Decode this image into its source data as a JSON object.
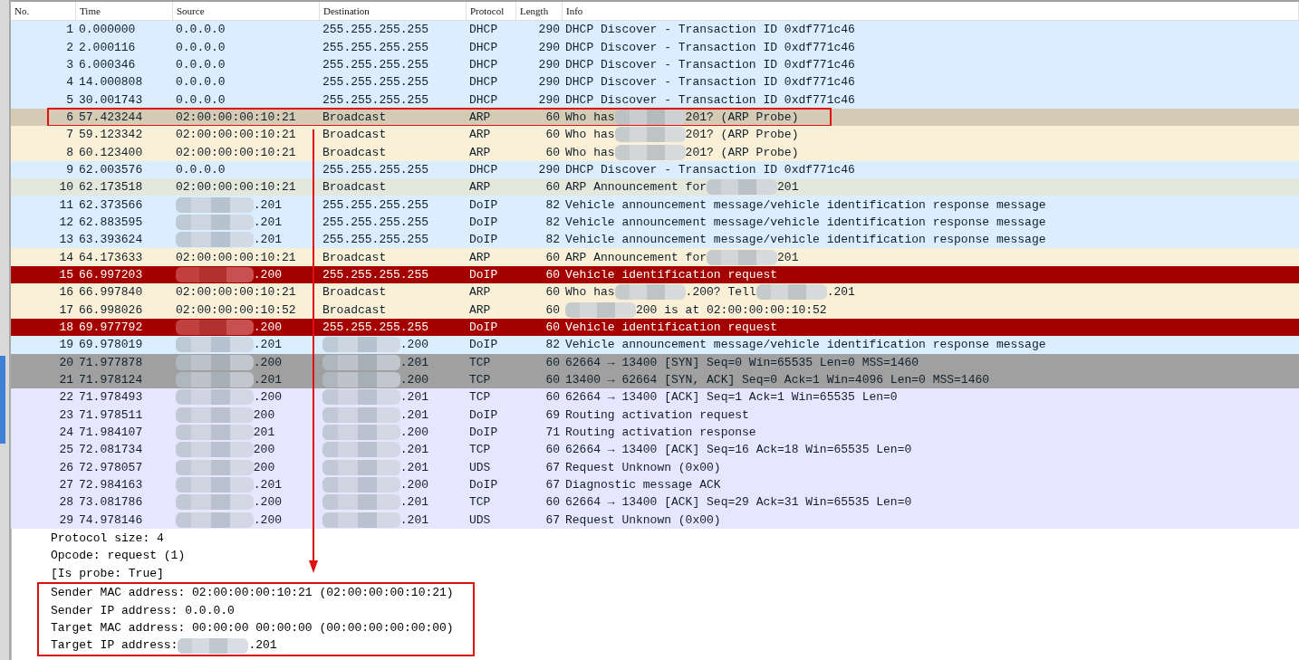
{
  "packet_list": {
    "columns": [
      "No.",
      "Time",
      "Source",
      "Destination",
      "Protocol",
      "Length",
      "Info"
    ],
    "rows": [
      {
        "no": "1",
        "time": "0.000000",
        "source": "0.0.0.0",
        "destination": "255.255.255.255",
        "protocol": "DHCP",
        "length": "290",
        "info": "DHCP Discover - Transaction ID 0xdf771c46",
        "color": "#daeeff",
        "highlighted": false
      },
      {
        "no": "2",
        "time": "2.000116",
        "source": "0.0.0.0",
        "destination": "255.255.255.255",
        "protocol": "DHCP",
        "length": "290",
        "info": "DHCP Discover - Transaction ID 0xdf771c46",
        "color": "#daeeff",
        "highlighted": false
      },
      {
        "no": "3",
        "time": "6.000346",
        "source": "0.0.0.0",
        "destination": "255.255.255.255",
        "protocol": "DHCP",
        "length": "290",
        "info": "DHCP Discover - Transaction ID 0xdf771c46",
        "color": "#daeeff",
        "highlighted": false
      },
      {
        "no": "4",
        "time": "14.000808",
        "source": "0.0.0.0",
        "destination": "255.255.255.255",
        "protocol": "DHCP",
        "length": "290",
        "info": "DHCP Discover - Transaction ID 0xdf771c46",
        "color": "#daeeff",
        "highlighted": false
      },
      {
        "no": "5",
        "time": "30.001743",
        "source": "0.0.0.0",
        "destination": "255.255.255.255",
        "protocol": "DHCP",
        "length": "290",
        "info": "DHCP Discover - Transaction ID 0xdf771c46",
        "color": "#daeeff",
        "highlighted": false
      },
      {
        "no": "6",
        "time": "57.423244",
        "source": "02:00:00:00:10:21",
        "destination": "Broadcast",
        "protocol": "ARP",
        "length": "60",
        "info": [
          {
            "kind": "text",
            "text": "Who has"
          },
          {
            "kind": "blur"
          },
          {
            "kind": "text",
            "text": "201? (ARP Probe)"
          }
        ],
        "color": "#d5cbb5",
        "highlighted": true
      },
      {
        "no": "7",
        "time": "59.123342",
        "source": "02:00:00:00:10:21",
        "destination": "Broadcast",
        "protocol": "ARP",
        "length": "60",
        "info": [
          {
            "kind": "text",
            "text": "Who has"
          },
          {
            "kind": "blur"
          },
          {
            "kind": "text",
            "text": "201? (ARP Probe)"
          }
        ],
        "color": "#faf0d8",
        "highlighted": false
      },
      {
        "no": "8",
        "time": "60.123400",
        "source": "02:00:00:00:10:21",
        "destination": "Broadcast",
        "protocol": "ARP",
        "length": "60",
        "info": [
          {
            "kind": "text",
            "text": "Who has"
          },
          {
            "kind": "blur"
          },
          {
            "kind": "text",
            "text": "201? (ARP Probe)"
          }
        ],
        "color": "#faf0d8",
        "highlighted": false
      },
      {
        "no": "9",
        "time": "62.003576",
        "source": "0.0.0.0",
        "destination": "255.255.255.255",
        "protocol": "DHCP",
        "length": "290",
        "info": "DHCP Discover - Transaction ID 0xdf771c46",
        "color": "#daeeff",
        "highlighted": false
      },
      {
        "no": "10",
        "time": "62.173518",
        "source": "02:00:00:00:10:21",
        "destination": "Broadcast",
        "protocol": "ARP",
        "length": "60",
        "info": [
          {
            "kind": "text",
            "text": "ARP Announcement for"
          },
          {
            "kind": "blur"
          },
          {
            "kind": "text",
            "text": "201"
          }
        ],
        "color": "#e3e7dc",
        "highlighted": false
      },
      {
        "no": "11",
        "time": "62.373566",
        "source": [
          {
            "kind": "blur"
          },
          {
            "kind": "text",
            "text": ".201"
          }
        ],
        "destination": "255.255.255.255",
        "protocol": "DoIP",
        "length": "82",
        "info": "Vehicle announcement message/vehicle identification response message",
        "color": "#daeeff",
        "highlighted": false
      },
      {
        "no": "12",
        "time": "62.883595",
        "source": [
          {
            "kind": "blur"
          },
          {
            "kind": "text",
            "text": ".201"
          }
        ],
        "destination": "255.255.255.255",
        "protocol": "DoIP",
        "length": "82",
        "info": "Vehicle announcement message/vehicle identification response message",
        "color": "#daeeff",
        "highlighted": false
      },
      {
        "no": "13",
        "time": "63.393624",
        "source": [
          {
            "kind": "blur"
          },
          {
            "kind": "text",
            "text": ".201"
          }
        ],
        "destination": "255.255.255.255",
        "protocol": "DoIP",
        "length": "82",
        "info": "Vehicle announcement message/vehicle identification response message",
        "color": "#daeeff",
        "highlighted": false
      },
      {
        "no": "14",
        "time": "64.173633",
        "source": "02:00:00:00:10:21",
        "destination": "Broadcast",
        "protocol": "ARP",
        "length": "60",
        "info": [
          {
            "kind": "text",
            "text": "ARP Announcement for"
          },
          {
            "kind": "blur"
          },
          {
            "kind": "text",
            "text": "201"
          }
        ],
        "color": "#faf0d8",
        "highlighted": false
      },
      {
        "no": "15",
        "time": "66.997203",
        "source": [
          {
            "kind": "blur"
          },
          {
            "kind": "text",
            "text": ".200"
          }
        ],
        "destination": "255.255.255.255",
        "protocol": "DoIP",
        "length": "60",
        "info": "Vehicle identification request",
        "color": "#a40000",
        "highlighted": false
      },
      {
        "no": "16",
        "time": "66.997840",
        "source": "02:00:00:00:10:21",
        "destination": "Broadcast",
        "protocol": "ARP",
        "length": "60",
        "info": [
          {
            "kind": "text",
            "text": "Who has"
          },
          {
            "kind": "blur"
          },
          {
            "kind": "text",
            "text": ".200? Tell"
          },
          {
            "kind": "blur"
          },
          {
            "kind": "text",
            "text": ".201"
          }
        ],
        "color": "#faf0d8",
        "highlighted": false
      },
      {
        "no": "17",
        "time": "66.998026",
        "source": "02:00:00:00:10:52",
        "destination": "Broadcast",
        "protocol": "ARP",
        "length": "60",
        "info": [
          {
            "kind": "blur"
          },
          {
            "kind": "text",
            "text": "200 is at 02:00:00:00:10:52"
          }
        ],
        "color": "#faf0d8",
        "highlighted": false
      },
      {
        "no": "18",
        "time": "69.977792",
        "source": [
          {
            "kind": "blur"
          },
          {
            "kind": "text",
            "text": ".200"
          }
        ],
        "destination": "255.255.255.255",
        "protocol": "DoIP",
        "length": "60",
        "info": "Vehicle identification request",
        "color": "#a40000",
        "highlighted": false
      },
      {
        "no": "19",
        "time": "69.978019",
        "source": [
          {
            "kind": "blur"
          },
          {
            "kind": "text",
            "text": ".201"
          }
        ],
        "destination": [
          {
            "kind": "blur"
          },
          {
            "kind": "text",
            "text": ".200"
          }
        ],
        "protocol": "DoIP",
        "length": "82",
        "info": "Vehicle announcement message/vehicle identification response message",
        "color": "#daeeff",
        "highlighted": false
      },
      {
        "no": "20",
        "time": "71.977878",
        "source": [
          {
            "kind": "blur"
          },
          {
            "kind": "text",
            "text": ".200"
          }
        ],
        "destination": [
          {
            "kind": "blur"
          },
          {
            "kind": "text",
            "text": ".201"
          }
        ],
        "protocol": "TCP",
        "length": "60",
        "info": "62664 → 13400 [SYN] Seq=0 Win=65535 Len=0 MSS=1460",
        "color": "#a0a0a0",
        "highlighted": false
      },
      {
        "no": "21",
        "time": "71.978124",
        "source": [
          {
            "kind": "blur"
          },
          {
            "kind": "text",
            "text": ".201"
          }
        ],
        "destination": [
          {
            "kind": "blur"
          },
          {
            "kind": "text",
            "text": ".200"
          }
        ],
        "protocol": "TCP",
        "length": "60",
        "info": "13400 → 62664 [SYN, ACK] Seq=0 Ack=1 Win=4096 Len=0 MSS=1460",
        "color": "#a0a0a0",
        "highlighted": false
      },
      {
        "no": "22",
        "time": "71.978493",
        "source": [
          {
            "kind": "blur"
          },
          {
            "kind": "text",
            "text": ".200"
          }
        ],
        "destination": [
          {
            "kind": "blur"
          },
          {
            "kind": "text",
            "text": ".201"
          }
        ],
        "protocol": "TCP",
        "length": "60",
        "info": "62664 → 13400 [ACK] Seq=1 Ack=1 Win=65535 Len=0",
        "color": "#e7e6ff",
        "highlighted": false
      },
      {
        "no": "23",
        "time": "71.978511",
        "source": [
          {
            "kind": "blur"
          },
          {
            "kind": "text",
            "text": "200"
          }
        ],
        "destination": [
          {
            "kind": "blur"
          },
          {
            "kind": "text",
            "text": ".201"
          }
        ],
        "protocol": "DoIP",
        "length": "69",
        "info": "Routing activation request",
        "color": "#e7e6ff",
        "highlighted": false
      },
      {
        "no": "24",
        "time": "71.984107",
        "source": [
          {
            "kind": "blur"
          },
          {
            "kind": "text",
            "text": "201"
          }
        ],
        "destination": [
          {
            "kind": "blur"
          },
          {
            "kind": "text",
            "text": ".200"
          }
        ],
        "protocol": "DoIP",
        "length": "71",
        "info": "Routing activation response",
        "color": "#e7e6ff",
        "highlighted": false
      },
      {
        "no": "25",
        "time": "72.081734",
        "source": [
          {
            "kind": "blur"
          },
          {
            "kind": "text",
            "text": "200"
          }
        ],
        "destination": [
          {
            "kind": "blur"
          },
          {
            "kind": "text",
            "text": ".201"
          }
        ],
        "protocol": "TCP",
        "length": "60",
        "info": "62664 → 13400 [ACK] Seq=16 Ack=18 Win=65535 Len=0",
        "color": "#e7e6ff",
        "highlighted": false
      },
      {
        "no": "26",
        "time": "72.978057",
        "source": [
          {
            "kind": "blur"
          },
          {
            "kind": "text",
            "text": "200"
          }
        ],
        "destination": [
          {
            "kind": "blur"
          },
          {
            "kind": "text",
            "text": ".201"
          }
        ],
        "protocol": "UDS",
        "length": "67",
        "info": "Request   Unknown (0x00)",
        "color": "#e7e6ff",
        "highlighted": false
      },
      {
        "no": "27",
        "time": "72.984163",
        "source": [
          {
            "kind": "blur"
          },
          {
            "kind": "text",
            "text": ".201"
          }
        ],
        "destination": [
          {
            "kind": "blur"
          },
          {
            "kind": "text",
            "text": ".200"
          }
        ],
        "protocol": "DoIP",
        "length": "67",
        "info": "Diagnostic message ACK",
        "color": "#e7e6ff",
        "highlighted": false
      },
      {
        "no": "28",
        "time": "73.081786",
        "source": [
          {
            "kind": "blur"
          },
          {
            "kind": "text",
            "text": ".200"
          }
        ],
        "destination": [
          {
            "kind": "blur"
          },
          {
            "kind": "text",
            "text": ".201"
          }
        ],
        "protocol": "TCP",
        "length": "60",
        "info": "62664 → 13400 [ACK] Seq=29 Ack=31 Win=65535 Len=0",
        "color": "#e7e6ff",
        "highlighted": false
      },
      {
        "no": "29",
        "time": "74.978146",
        "source": [
          {
            "kind": "blur"
          },
          {
            "kind": "text",
            "text": ".200"
          }
        ],
        "destination": [
          {
            "kind": "blur"
          },
          {
            "kind": "text",
            "text": ".201"
          }
        ],
        "protocol": "UDS",
        "length": "67",
        "info": "Request   Unknown (0x00)",
        "color": "#e7e6ff",
        "highlighted": false
      }
    ]
  },
  "packet_details": {
    "lines": [
      {
        "text": [
          {
            "kind": "text",
            "text": "Protocol size: 4"
          }
        ],
        "boxed": false
      },
      {
        "text": [
          {
            "kind": "text",
            "text": "Opcode: request (1)"
          }
        ],
        "boxed": false
      },
      {
        "text": [
          {
            "kind": "text",
            "text": "[Is probe: True]"
          }
        ],
        "boxed": false
      },
      {
        "text": [
          {
            "kind": "text",
            "text": "Sender MAC address: 02:00:00:00:10:21 (02:00:00:00:10:21)"
          }
        ],
        "boxed": true
      },
      {
        "text": [
          {
            "kind": "text",
            "text": "Sender IP address: 0.0.0.0"
          }
        ],
        "boxed": true
      },
      {
        "text": [
          {
            "kind": "text",
            "text": "Target MAC address: 00:00:00 00:00:00 (00:00:00:00:00:00)"
          }
        ],
        "boxed": true
      },
      {
        "text": [
          {
            "kind": "text",
            "text": "Target IP address:"
          },
          {
            "kind": "blur"
          },
          {
            "kind": "text",
            "text": ".201"
          }
        ],
        "boxed": true
      }
    ]
  }
}
